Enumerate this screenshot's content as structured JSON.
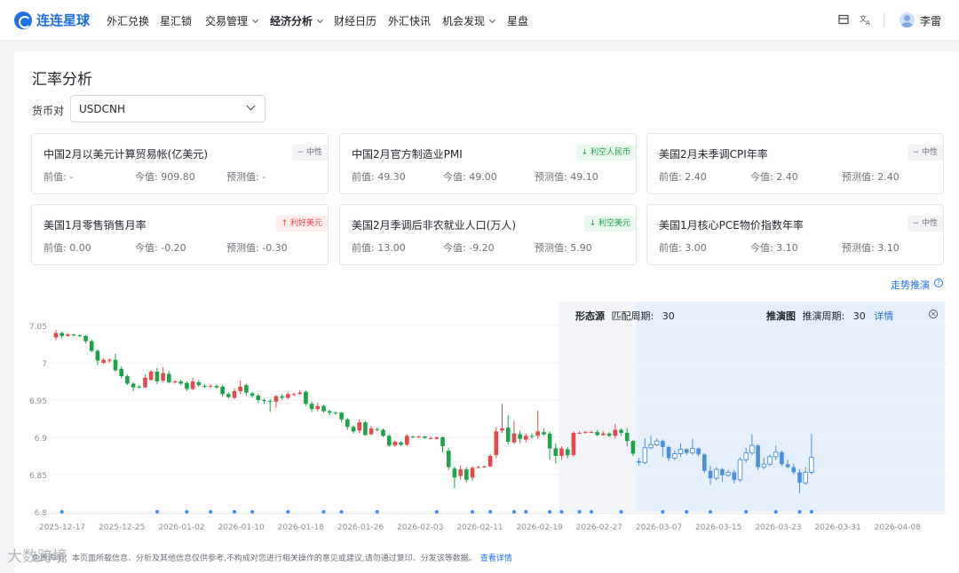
{
  "brand": {
    "name": "连连星球",
    "accent": "#1e6fe8"
  },
  "nav": {
    "items": [
      {
        "label": "外汇兑换",
        "dropdown": false,
        "active": false
      },
      {
        "label": "星汇锁",
        "dropdown": false,
        "active": false
      },
      {
        "label": "交易管理",
        "dropdown": true,
        "active": false
      },
      {
        "label": "经济分析",
        "dropdown": true,
        "active": true
      },
      {
        "label": "财经日历",
        "dropdown": false,
        "active": false
      },
      {
        "label": "外汇快讯",
        "dropdown": false,
        "active": false
      },
      {
        "label": "机会发现",
        "dropdown": true,
        "active": false
      },
      {
        "label": "星盘",
        "dropdown": false,
        "active": false
      }
    ],
    "icons": [
      "layout-icon",
      "translate-icon"
    ],
    "user_name": "李雷"
  },
  "page": {
    "title": "汇率分析",
    "pair_label": "货币对",
    "pair_value": "USDCNH",
    "trend_link": "走势推演",
    "footer_text": "免责声明：本页面所载信息、分析及其他信息仅供参考,不构成对您进行相关操作的意见或建议,请勿通过复印、分发该等数据。",
    "footer_link": "查看详情",
    "watermark": "大数跨境"
  },
  "value_labels": {
    "prev": "前值:",
    "curr": "今值:",
    "forecast": "预测值:"
  },
  "indicators": [
    {
      "title": "中国2月以美元计算贸易帐(亿美元)",
      "tag": "中性",
      "tag_type": "neutral",
      "prev": "-",
      "curr": "909.80",
      "forecast": "-"
    },
    {
      "title": "中国2月官方制造业PMI",
      "tag": "利空人民币",
      "tag_type": "green",
      "prev": "49.30",
      "curr": "49.00",
      "forecast": "49.10"
    },
    {
      "title": "美国2月未季调CPI年率",
      "tag": "中性",
      "tag_type": "neutral",
      "prev": "2.40",
      "curr": "2.40",
      "forecast": "2.40"
    },
    {
      "title": "美国1月零售销售月率",
      "tag": "利好美元",
      "tag_type": "red",
      "prev": "0.00",
      "curr": "-0.20",
      "forecast": "-0.30"
    },
    {
      "title": "美国2月季调后非农就业人口(万人)",
      "tag": "利空美元",
      "tag_type": "green",
      "prev": "13.00",
      "curr": "-9.20",
      "forecast": "5.90"
    },
    {
      "title": "美国1月核心PCE物价指数年率",
      "tag": "中性",
      "tag_type": "neutral",
      "prev": "3.00",
      "curr": "3.10",
      "forecast": "3.10"
    }
  ],
  "zones": {
    "pattern": {
      "title": "形态源",
      "period_label": "匹配周期:",
      "period": "30"
    },
    "projection": {
      "title": "推演图",
      "period_label": "推演周期:",
      "period": "30",
      "detail_link": "详情"
    }
  },
  "colors": {
    "up": "#e5484d",
    "down": "#1aa34a",
    "projection": "#4a90e2",
    "pattern_bg": "#f2f4f7",
    "projection_bg": "#e6f0fc",
    "event_dot": "#3d8ef0"
  },
  "chart_data": {
    "type": "candlestick",
    "symbol": "USDCNH",
    "y_ticks": [
      "7.05",
      "7",
      "6.95",
      "6.9",
      "6.85",
      "6.8"
    ],
    "ylim": [
      6.8,
      7.05
    ],
    "x_ticks": [
      "2025-12-17",
      "2025-12-25",
      "2026-01-02",
      "2026-01-10",
      "2026-01-18",
      "2026-01-26",
      "2026-02-03",
      "2026-02-11",
      "2026-02-19",
      "2026-02-27",
      "2026-03-07",
      "2026-03-15",
      "2026-03-23",
      "2026-03-31",
      "2026-04-08"
    ],
    "candles": [
      [
        7.034,
        7.04,
        7.044,
        7.03
      ],
      [
        7.04,
        7.036,
        7.042,
        7.033
      ],
      [
        7.036,
        7.038,
        7.04,
        7.035
      ],
      [
        7.038,
        7.037,
        7.039,
        7.035
      ],
      [
        7.037,
        7.036,
        7.038,
        7.034
      ],
      [
        7.036,
        7.029,
        7.037,
        7.026
      ],
      [
        7.029,
        7.016,
        7.031,
        7.014
      ],
      [
        7.016,
        7.003,
        7.018,
        6.997
      ],
      [
        7.0,
        7.004,
        7.006,
        6.998
      ],
      [
        7.003,
        7.004,
        7.006,
        7.0
      ],
      [
        7.004,
        6.99,
        7.012,
        6.988
      ],
      [
        6.992,
        6.982,
        6.995,
        6.979
      ],
      [
        6.982,
        6.972,
        6.984,
        6.97
      ],
      [
        6.972,
        6.967,
        6.974,
        6.962
      ],
      [
        6.968,
        6.967,
        6.97,
        6.965
      ],
      [
        6.967,
        6.98,
        6.984,
        6.966
      ],
      [
        6.977,
        6.988,
        6.99,
        6.976
      ],
      [
        6.988,
        6.975,
        6.993,
        6.971
      ],
      [
        6.976,
        6.986,
        6.994,
        6.974
      ],
      [
        6.985,
        6.974,
        6.989,
        6.972
      ],
      [
        6.974,
        6.975,
        6.977,
        6.972
      ],
      [
        6.975,
        6.972,
        6.977,
        6.97
      ],
      [
        6.973,
        6.965,
        6.975,
        6.962
      ],
      [
        6.965,
        6.975,
        6.98,
        6.963
      ],
      [
        6.974,
        6.97,
        6.977,
        6.968
      ],
      [
        6.969,
        6.968,
        6.971,
        6.966
      ],
      [
        6.968,
        6.969,
        6.971,
        6.966
      ],
      [
        6.969,
        6.967,
        6.971,
        6.965
      ],
      [
        6.968,
        6.958,
        6.97,
        6.955
      ],
      [
        6.958,
        6.954,
        6.961,
        6.952
      ],
      [
        6.953,
        6.962,
        6.966,
        6.951
      ],
      [
        6.962,
        6.968,
        6.976,
        6.958
      ],
      [
        6.97,
        6.96,
        6.972,
        6.956
      ],
      [
        6.959,
        6.956,
        6.961,
        6.953
      ],
      [
        6.956,
        6.95,
        6.958,
        6.946
      ],
      [
        6.95,
        6.949,
        6.952,
        6.945
      ],
      [
        6.949,
        6.948,
        6.951,
        6.934
      ],
      [
        6.948,
        6.955,
        6.957,
        6.94
      ],
      [
        6.955,
        6.953,
        6.958,
        6.95
      ],
      [
        6.953,
        6.958,
        6.961,
        6.951
      ],
      [
        6.958,
        6.958,
        6.96,
        6.955
      ],
      [
        6.958,
        6.96,
        6.963,
        6.957
      ],
      [
        6.961,
        6.945,
        6.963,
        6.942
      ],
      [
        6.945,
        6.938,
        6.948,
        6.934
      ],
      [
        6.938,
        6.942,
        6.946,
        6.935
      ],
      [
        6.942,
        6.935,
        6.944,
        6.933
      ],
      [
        6.935,
        6.933,
        6.937,
        6.93
      ],
      [
        6.933,
        6.932,
        6.935,
        6.93
      ],
      [
        6.933,
        6.924,
        6.934,
        6.92
      ],
      [
        6.924,
        6.914,
        6.926,
        6.91
      ],
      [
        6.914,
        6.908,
        6.916,
        6.905
      ],
      [
        6.909,
        6.92,
        6.924,
        6.906
      ],
      [
        6.92,
        6.903,
        6.922,
        6.902
      ],
      [
        6.904,
        6.912,
        6.915,
        6.903
      ],
      [
        6.911,
        6.91,
        6.913,
        6.908
      ],
      [
        6.91,
        6.902,
        6.912,
        6.9
      ],
      [
        6.902,
        6.889,
        6.904,
        6.887
      ],
      [
        6.889,
        6.894,
        6.896,
        6.887
      ],
      [
        6.893,
        6.89,
        6.895,
        6.888
      ],
      [
        6.89,
        6.902,
        6.904,
        6.888
      ],
      [
        6.901,
        6.9,
        6.902,
        6.899
      ],
      [
        6.9,
        6.901,
        6.902,
        6.899
      ],
      [
        6.901,
        6.899,
        6.902,
        6.898
      ],
      [
        6.899,
        6.899,
        6.901,
        6.897
      ],
      [
        6.898,
        6.9,
        6.901,
        6.897
      ],
      [
        6.9,
        6.888,
        6.901,
        6.88
      ],
      [
        6.882,
        6.86,
        6.885,
        6.856
      ],
      [
        6.858,
        6.846,
        6.861,
        6.832
      ],
      [
        6.848,
        6.857,
        6.862,
        6.843
      ],
      [
        6.857,
        6.843,
        6.86,
        6.839
      ],
      [
        6.846,
        6.859,
        6.861,
        6.842
      ],
      [
        6.859,
        6.86,
        6.862,
        6.858
      ],
      [
        6.86,
        6.861,
        6.862,
        6.859
      ],
      [
        6.861,
        6.875,
        6.878,
        6.86
      ],
      [
        6.876,
        6.908,
        6.914,
        6.872
      ],
      [
        6.909,
        6.912,
        6.945,
        6.906
      ],
      [
        6.913,
        6.894,
        6.93,
        6.89
      ],
      [
        6.893,
        6.905,
        6.922,
        6.891
      ],
      [
        6.904,
        6.898,
        6.909,
        6.892
      ],
      [
        6.897,
        6.902,
        6.905,
        6.893
      ],
      [
        6.902,
        6.901,
        6.905,
        6.898
      ],
      [
        6.902,
        6.908,
        6.936,
        6.898
      ],
      [
        6.907,
        6.904,
        6.912,
        6.902
      ],
      [
        6.905,
        6.885,
        6.908,
        6.87
      ],
      [
        6.885,
        6.875,
        6.892,
        6.865
      ],
      [
        6.875,
        6.885,
        6.888,
        6.87
      ],
      [
        6.884,
        6.876,
        6.887,
        6.872
      ],
      [
        6.876,
        6.906,
        6.908,
        6.874
      ],
      [
        6.906,
        6.906,
        6.908,
        6.905
      ],
      [
        6.906,
        6.907,
        6.909,
        6.905
      ],
      [
        6.907,
        6.907,
        6.909,
        6.906
      ],
      [
        6.907,
        6.903,
        6.91,
        6.902
      ],
      [
        6.903,
        6.905,
        6.908,
        6.902
      ],
      [
        6.905,
        6.902,
        6.907,
        6.9
      ],
      [
        6.902,
        6.91,
        6.918,
        6.898
      ],
      [
        6.91,
        6.906,
        6.912,
        6.902
      ],
      [
        6.906,
        6.895,
        6.912,
        6.888
      ],
      [
        6.895,
        6.878,
        6.896,
        6.875
      ]
    ],
    "projection": [
      [
        6.868,
        6.866,
        6.872,
        6.862
      ],
      [
        6.866,
        6.886,
        6.899,
        6.864
      ],
      [
        6.886,
        6.89,
        6.902,
        6.884
      ],
      [
        6.89,
        6.895,
        6.899,
        6.888
      ],
      [
        6.895,
        6.887,
        6.897,
        6.874
      ],
      [
        6.887,
        6.872,
        6.889,
        6.868
      ],
      [
        6.872,
        6.878,
        6.883,
        6.869
      ],
      [
        6.878,
        6.884,
        6.892,
        6.874
      ],
      [
        6.884,
        6.879,
        6.885,
        6.876
      ],
      [
        6.879,
        6.885,
        6.898,
        6.876
      ],
      [
        6.885,
        6.877,
        6.886,
        6.874
      ],
      [
        6.877,
        6.855,
        6.879,
        6.852
      ],
      [
        6.855,
        6.845,
        6.862,
        6.836
      ],
      [
        6.845,
        6.857,
        6.86,
        6.842
      ],
      [
        6.857,
        6.849,
        6.859,
        6.84
      ],
      [
        6.849,
        6.853,
        6.857,
        6.847
      ],
      [
        6.853,
        6.843,
        6.856,
        6.838
      ],
      [
        6.843,
        6.87,
        6.873,
        6.84
      ],
      [
        6.87,
        6.879,
        6.886,
        6.866
      ],
      [
        6.879,
        6.889,
        6.904,
        6.876
      ],
      [
        6.889,
        6.86,
        6.891,
        6.856
      ],
      [
        6.86,
        6.864,
        6.873,
        6.857
      ],
      [
        6.864,
        6.874,
        6.877,
        6.861
      ],
      [
        6.874,
        6.88,
        6.889,
        6.87
      ],
      [
        6.88,
        6.864,
        6.882,
        6.861
      ],
      [
        6.864,
        6.86,
        6.87,
        6.858
      ],
      [
        6.86,
        6.853,
        6.865,
        6.85
      ],
      [
        6.853,
        6.839,
        6.857,
        6.825
      ],
      [
        6.839,
        6.853,
        6.86,
        6.836
      ],
      [
        6.853,
        6.873,
        6.904,
        6.85
      ]
    ],
    "event_dot_indices": [
      1,
      17,
      22,
      26,
      30,
      33,
      39,
      45,
      48,
      54,
      64,
      70,
      73,
      77,
      79,
      83,
      85,
      88,
      90,
      95,
      102,
      106,
      110,
      116,
      121,
      125,
      127
    ]
  }
}
